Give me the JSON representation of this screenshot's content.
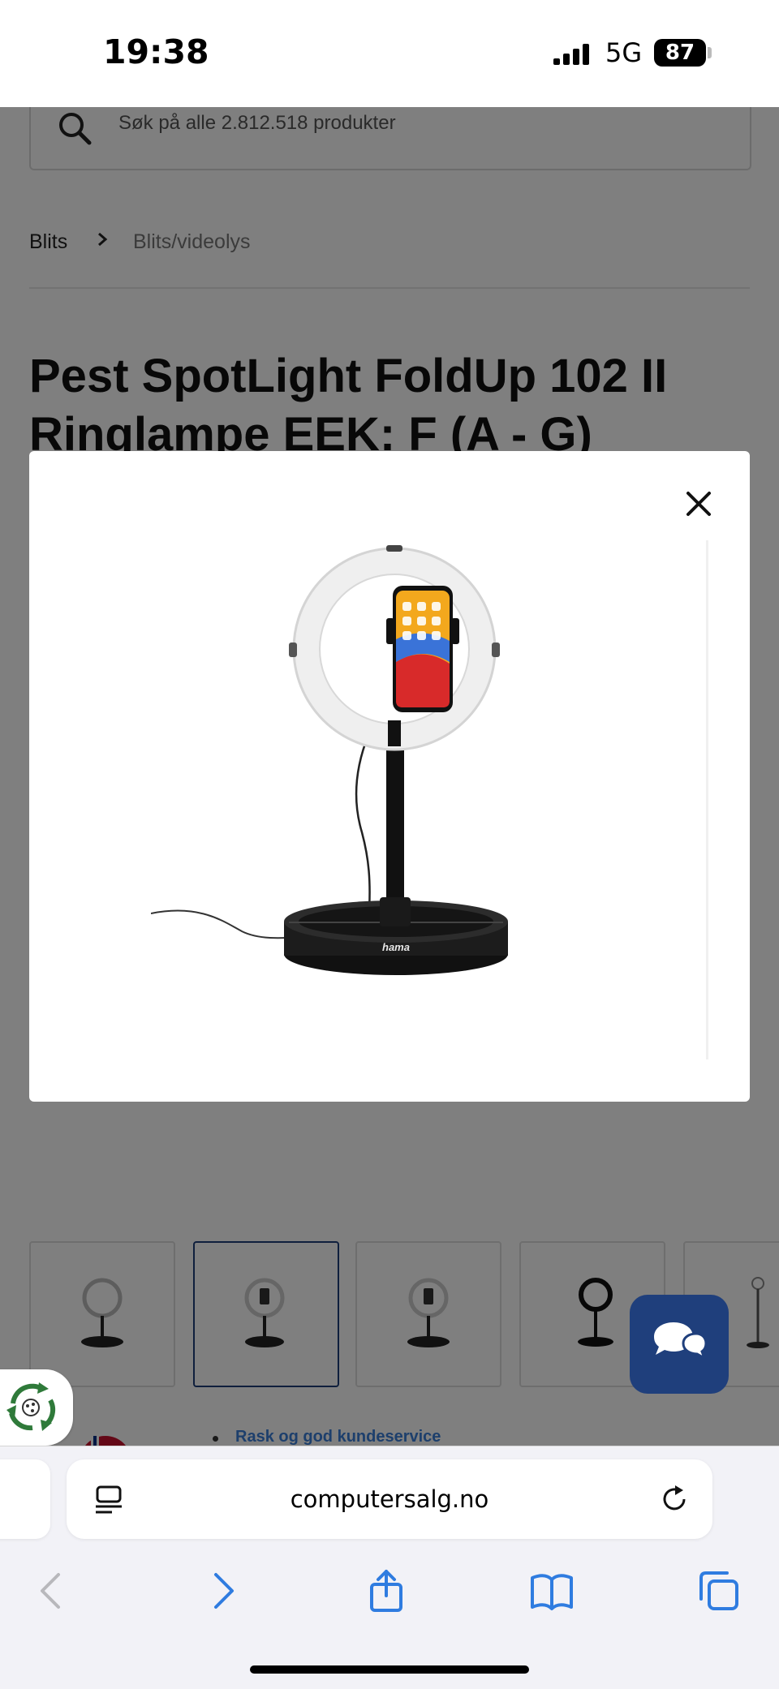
{
  "status_bar": {
    "time": "19:38",
    "network": "5G",
    "battery": "87"
  },
  "page": {
    "search_placeholder": "Søk på alle 2.812.518 produkter",
    "breadcrumb": [
      "Blits",
      "Blits/videolys"
    ],
    "title": "Pest SpotLight FoldUp 102 II Ringlampe EEK: F (A - G)",
    "feature_text": "Rask og god kundeservice",
    "thumbnails_count": 5,
    "active_thumbnail": 2
  },
  "modal": {
    "brand_text": "hama"
  },
  "browser": {
    "address": "computersalg.no"
  },
  "colors": {
    "accent": "#1f3f7c",
    "link": "#3b7ed8",
    "safari_blue": "#2f7ce0"
  }
}
